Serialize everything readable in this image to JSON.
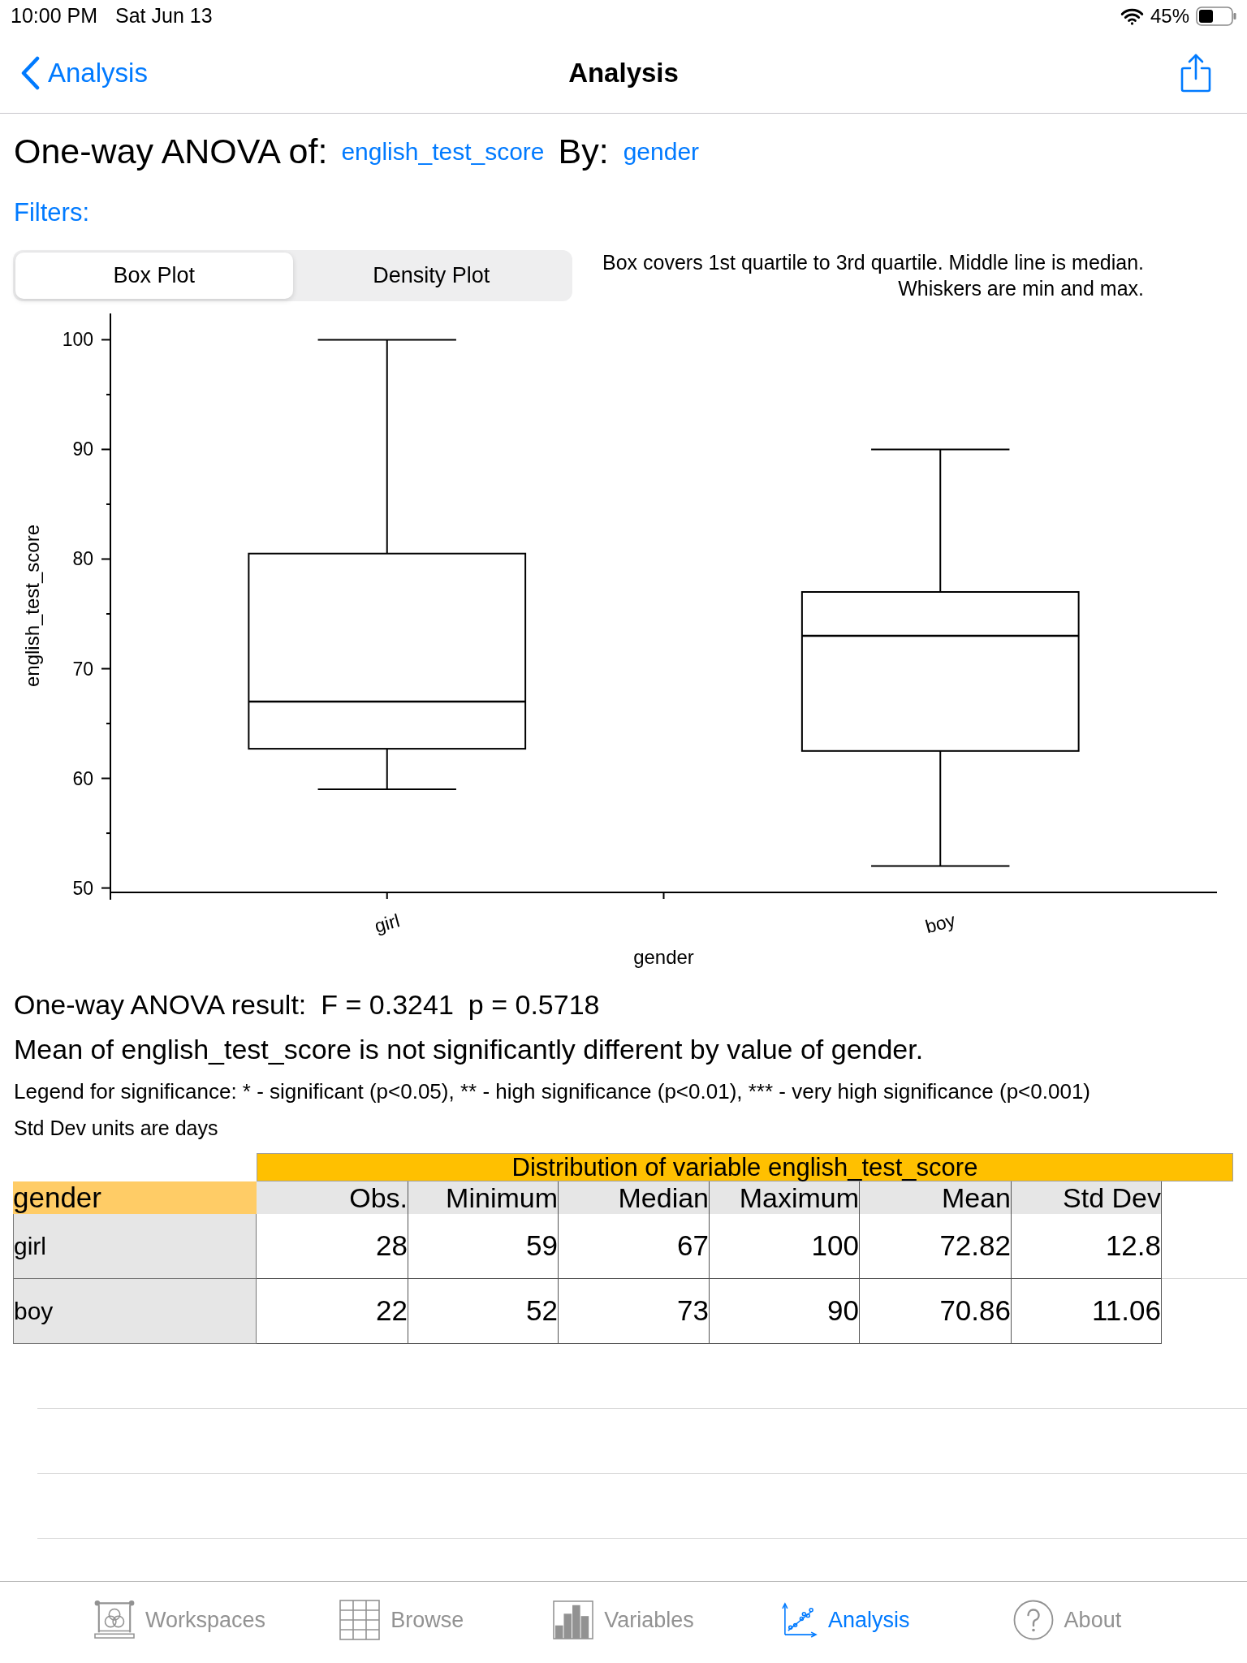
{
  "status_bar": {
    "time": "10:00 PM",
    "date": "Sat Jun 13",
    "battery": "45%"
  },
  "nav_bar": {
    "back_label": "Analysis",
    "title": "Analysis"
  },
  "heading": {
    "prefix": "One-way ANOVA of:",
    "variable": "english_test_score",
    "by_label": "By:",
    "group": "gender"
  },
  "filters": {
    "label": "Filters:"
  },
  "plot_tabs": [
    {
      "label": "Box Plot",
      "selected": true
    },
    {
      "label": "Density Plot",
      "selected": false
    }
  ],
  "plot_note": [
    "Box covers 1st quartile to 3rd quartile. Middle line is median.",
    "Whiskers are min and max."
  ],
  "chart": {
    "chart_data": {
      "type": "candlestick",
      "xlabel": "gender",
      "ylabel": "english_test_score",
      "categories": [
        "girl",
        "boy"
      ],
      "ohlc": [
        [
          62.7,
          100,
          59,
          80.5
        ],
        [
          62.5,
          90,
          52,
          77
        ]
      ],
      "ref_lines": [
        {
          "axis": "y",
          "value": 67
        },
        {
          "axis": "y",
          "value": 73
        }
      ],
      "ylim": [
        49.6,
        102.4
      ],
      "yticks": [
        50,
        60,
        70,
        80,
        90,
        100
      ]
    }
  },
  "result": {
    "label": "One-way ANOVA result:",
    "f_statistic": "F = 0.3241",
    "p_value": "p = 0.5718",
    "conclusion": "Mean of english_test_score is not significantly different by value of gender.",
    "legend": "Legend for significance: * - significant (p<0.05), ** - high significance (p<0.01), *** - very high significance (p<0.001)",
    "units_note": "Std Dev units are days"
  },
  "table": {
    "title": "Distribution of variable english_test_score",
    "group_header": "gender",
    "columns": [
      "Obs.",
      "Minimum",
      "Median",
      "Maximum",
      "Mean",
      "Std Dev"
    ],
    "rows": [
      {
        "label": "girl",
        "cells": [
          "28",
          "59",
          "67",
          "100",
          "72.82",
          "12.8"
        ]
      },
      {
        "label": "boy",
        "cells": [
          "22",
          "52",
          "73",
          "90",
          "70.86",
          "11.06"
        ]
      }
    ]
  },
  "tab_bar": [
    {
      "label": "Workspaces",
      "selected": false
    },
    {
      "label": "Browse",
      "selected": false
    },
    {
      "label": "Variables",
      "selected": false
    },
    {
      "label": "Analysis",
      "selected": true
    },
    {
      "label": "About",
      "selected": false
    }
  ]
}
